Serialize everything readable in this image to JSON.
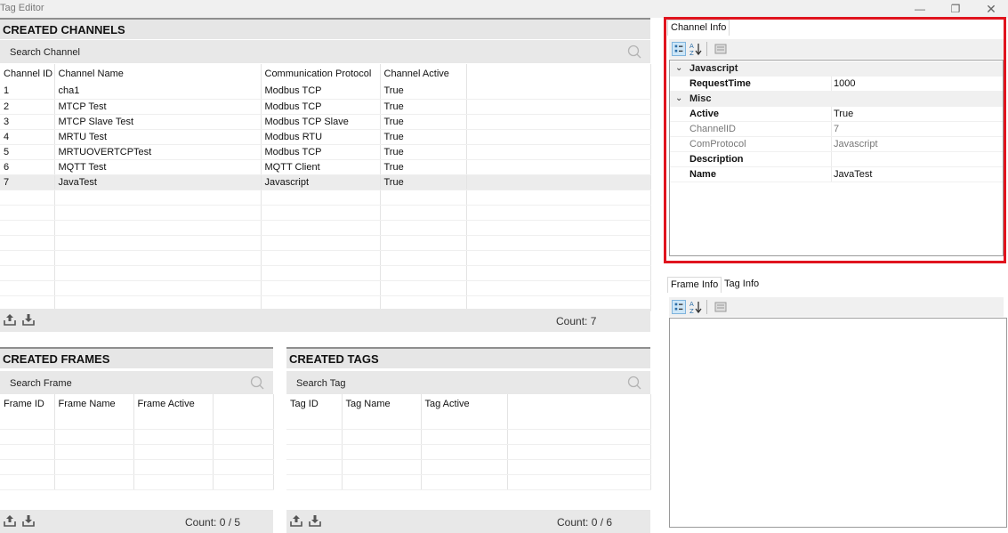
{
  "window": {
    "title": "Tag Editor",
    "minimize": "—",
    "maximize": "❐",
    "close": "✕"
  },
  "channels": {
    "header": "CREATED CHANNELS",
    "search_placeholder": "Search Channel",
    "columns": [
      "Channel ID",
      "Channel Name",
      "Communication Protocol",
      "Channel Active"
    ],
    "rows": [
      [
        "1",
        "cha1",
        "Modbus TCP",
        "True"
      ],
      [
        "2",
        "MTCP Test",
        "Modbus TCP",
        "True"
      ],
      [
        "3",
        "MTCP Slave Test",
        "Modbus TCP Slave",
        "True"
      ],
      [
        "4",
        "MRTU Test",
        "Modbus RTU",
        "True"
      ],
      [
        "5",
        "MRTUOVERTCPTest",
        "Modbus TCP",
        "True"
      ],
      [
        "6",
        "MQTT Test",
        "MQTT Client",
        "True"
      ],
      [
        "7",
        "JavaTest",
        "Javascript",
        "True"
      ]
    ],
    "selected_row": 7,
    "count": "Count: 7"
  },
  "frames": {
    "header": "CREATED FRAMES",
    "search_placeholder": "Search Frame",
    "columns": [
      "Frame ID",
      "Frame Name",
      "Frame Active"
    ],
    "count": "Count: 0 / 5"
  },
  "tags": {
    "header": "CREATED TAGS",
    "search_placeholder": "Search Tag",
    "columns": [
      "Tag ID",
      "Tag Name",
      "Tag Active"
    ],
    "count": "Count: 0 / 6"
  },
  "channel_info": {
    "tab": "Channel Info",
    "categories": [
      {
        "name": "Javascript",
        "props": [
          {
            "name": "RequestTime",
            "value": "1000",
            "readonly": false
          }
        ]
      },
      {
        "name": "Misc",
        "props": [
          {
            "name": "Active",
            "value": "True",
            "readonly": false
          },
          {
            "name": "ChannelID",
            "value": "7",
            "readonly": true
          },
          {
            "name": "ComProtocol",
            "value": "Javascript",
            "readonly": true
          },
          {
            "name": "Description",
            "value": "",
            "readonly": false
          },
          {
            "name": "Name",
            "value": "JavaTest",
            "readonly": false
          }
        ]
      }
    ]
  },
  "frame_info": {
    "tabs": [
      "Frame Info",
      "Tag Info"
    ],
    "active_tab": "Frame Info"
  },
  "icons": {
    "export": "upload-icon",
    "import": "download-icon",
    "search": "search-icon",
    "categorized": "categorized-icon",
    "alphabetical": "sort-alpha-icon",
    "property_pages": "property-pages-icon"
  },
  "colors": {
    "highlight": "#e0141e",
    "header_bg": "#e6e6e6",
    "selected_row": "#ececec"
  }
}
